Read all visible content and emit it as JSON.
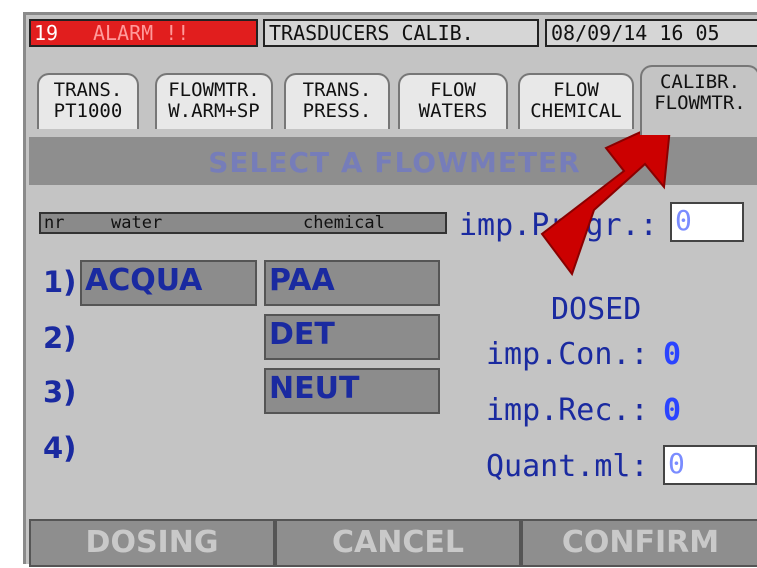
{
  "status": {
    "alarm_number": "19",
    "alarm_text": "ALARM !!",
    "page_title": "TRASDUCERS CALIB.",
    "datetime": "08/09/14  16 05"
  },
  "tabs": [
    {
      "line1": "TRANS.",
      "line2": "PT1000"
    },
    {
      "line1": "FLOWMTR.",
      "line2": "W.ARM+SP"
    },
    {
      "line1": "TRANS.",
      "line2": "PRESS."
    },
    {
      "line1": "FLOW",
      "line2": "WATERS"
    },
    {
      "line1": "FLOW",
      "line2": "CHEMICAL"
    },
    {
      "line1": "CALIBR.",
      "line2": "FLOWMTR.",
      "active": true
    }
  ],
  "section_title": "SELECT A FLOWMETER",
  "table": {
    "headers": {
      "nr": "nr",
      "water": "water",
      "chemical": "chemical"
    },
    "rows": [
      {
        "nr": "1)",
        "water": "ACQUA",
        "chemical": "PAA"
      },
      {
        "nr": "2)",
        "water": "",
        "chemical": "DET"
      },
      {
        "nr": "3)",
        "water": "",
        "chemical": "NEUT"
      },
      {
        "nr": "4)",
        "water": "",
        "chemical": ""
      }
    ]
  },
  "fields": {
    "imp_progr_label": "imp.Progr.:",
    "imp_progr_value": "0",
    "dosed_title": "DOSED",
    "imp_con_label": "imp.Con.:",
    "imp_con_value": "0",
    "imp_rec_label": "imp.Rec.:",
    "imp_rec_value": "0",
    "quant_label": "Quant.ml:",
    "quant_value": "0"
  },
  "buttons": {
    "dosing": "DOSING",
    "cancel": "CANCEL",
    "confirm": "CONFIRM"
  },
  "colors": {
    "alarm_bg": "#e11e1e",
    "text_blue": "#1a2aa0",
    "arrow_red": "#cc0000"
  }
}
